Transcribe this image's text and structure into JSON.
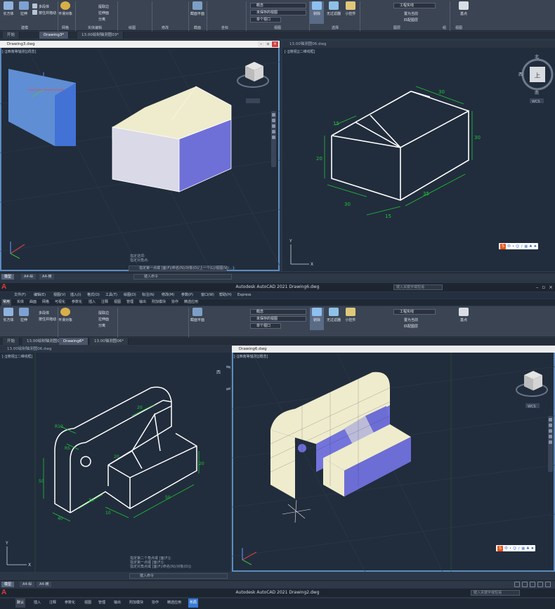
{
  "top_ribbon": {
    "box_label": "长方体",
    "extrude_label": "拉伸",
    "polysolid_label": "多段体",
    "presspull_label": "按住并拖动",
    "smooth_label": "平滑对象",
    "group_modeling": "建模",
    "group_mesh": "网格",
    "group_solid_edit": "实体编辑",
    "group_draw": "绘图",
    "group_modify": "修改",
    "group_section": "截面",
    "group_coords": "坐标",
    "group_view": "视图",
    "group_selection": "选择",
    "group_layers": "图层",
    "group_groups": "组",
    "group_view2": "视图",
    "extract_edges": "提取边",
    "extrude_face": "拉伸面",
    "separate": "分离",
    "section_plane": "截面平面",
    "visual_style": "概念",
    "view_dropdown": "未保存的视图",
    "viewport_config": "单个视口",
    "culling": "剔除",
    "gizmo": "小控件",
    "filter": "无过滤器",
    "layer_name": "工程实线",
    "layer_state": "置为当前",
    "layer_match": "匹配图层",
    "group_btn": "组",
    "base_btn": "基点"
  },
  "top_tabs": [
    "开始",
    "Drawing3*",
    "13.00绘制轴测图03*"
  ],
  "vp1": {
    "title": "Drawing3.dwg",
    "label": "[-][西南等轴测][概念]"
  },
  "vp2": {
    "title": "13.00轴测图06.dwg",
    "label": "[-][俯视][二维线框]",
    "viewcube_top": "上",
    "viewcube_n": "北",
    "viewcube_s": "南",
    "viewcube_w": "西",
    "viewcube_e": "东",
    "wcs": "WCS",
    "dims": [
      "30",
      "15",
      "30",
      "20",
      "35",
      "15",
      "30",
      "30"
    ]
  },
  "top_cmd": {
    "history": [
      "指定选项:",
      "指定对角点:"
    ],
    "prompt": "指定第一点或 [面(F)/命名(N)/对象(O)/上一个(L)/视图(V)/...]:"
  },
  "mid_status": {
    "tabs": [
      "模型",
      "A4-纵",
      "A4-横"
    ],
    "cmd": "键入命令"
  },
  "app2": {
    "title": "Autodesk AutoCAD 2021    Drawing6.dwg",
    "search": "键入关键字或短语",
    "menu": [
      "文件(F)",
      "编辑(E)",
      "视图(V)",
      "插入(I)",
      "格式(O)",
      "工具(T)",
      "绘图(D)",
      "标注(N)",
      "修改(M)",
      "参数(P)",
      "窗口(W)",
      "帮助(H)",
      "Express"
    ],
    "ribbon_tabs": [
      "常用",
      "实体",
      "曲面",
      "网格",
      "可视化",
      "参数化",
      "插入",
      "注释",
      "视图",
      "管理",
      "输出",
      "附加模块",
      "协作",
      "精选应用"
    ],
    "tabs": [
      "开始",
      "13.00绘制轴测图06.dwg",
      "Drawing6*",
      "13.00轴测图06*"
    ]
  },
  "vp3": {
    "title": "13.00绘制轴测图06.dwg",
    "label": "[-][俯视][二维线框]",
    "dims": [
      "R10",
      "R5",
      "50",
      "20",
      "20",
      "50",
      "30",
      "40",
      "10",
      "20"
    ],
    "compass_w": "西"
  },
  "vp4": {
    "title": "Drawing6.dwg",
    "label": "[-][西南等轴测][概念]",
    "wcs": "WCS"
  },
  "bottom_cmd": {
    "history": [
      "指定第二个角点或 [面(F)]:",
      "指定第一点或 [面(F)]:",
      "指定对角点或 [面(F)/命名(N)/对象(O)]:"
    ],
    "prompt": "键入命令"
  },
  "bottom_status": {
    "tabs": [
      "模型",
      "A4-纵",
      "A4-横"
    ]
  },
  "app3": {
    "title": "Autodesk AutoCAD 2021    Drawing2.dwg",
    "search": "键入关键字或短语",
    "ribbon_tabs": [
      "默认",
      "插入",
      "注释",
      "参数化",
      "视图",
      "管理",
      "输出",
      "附加模块",
      "协作",
      "精选应用",
      "布局"
    ]
  },
  "colors": {
    "face_top": "#efeccd",
    "face_front": "#c9c9dc",
    "face_side": "#6f6fd8",
    "dim_green": "#22c23a",
    "selection_blue": "#5a8ce8"
  }
}
